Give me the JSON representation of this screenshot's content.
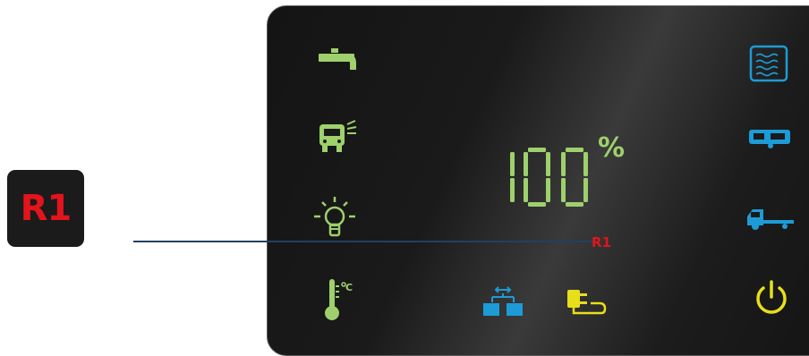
{
  "badge": {
    "label": "R1"
  },
  "display": {
    "value": "100",
    "unit": "%"
  },
  "callout": {
    "label": "R1"
  },
  "colors": {
    "green": "#9ed06c",
    "blue": "#1d9bd7",
    "yellow": "#e8df1a",
    "red": "#e3141c"
  },
  "icons": {
    "left": [
      "water-tap-icon",
      "vehicle-headlight-icon",
      "light-bulb-icon",
      "thermometer-celsius-icon"
    ],
    "right": [
      "water-heater-icon",
      "caravan-icon",
      "tow-vehicle-icon",
      "power-icon"
    ],
    "bottom": [
      "battery-link-icon",
      "mains-plug-icon"
    ]
  }
}
